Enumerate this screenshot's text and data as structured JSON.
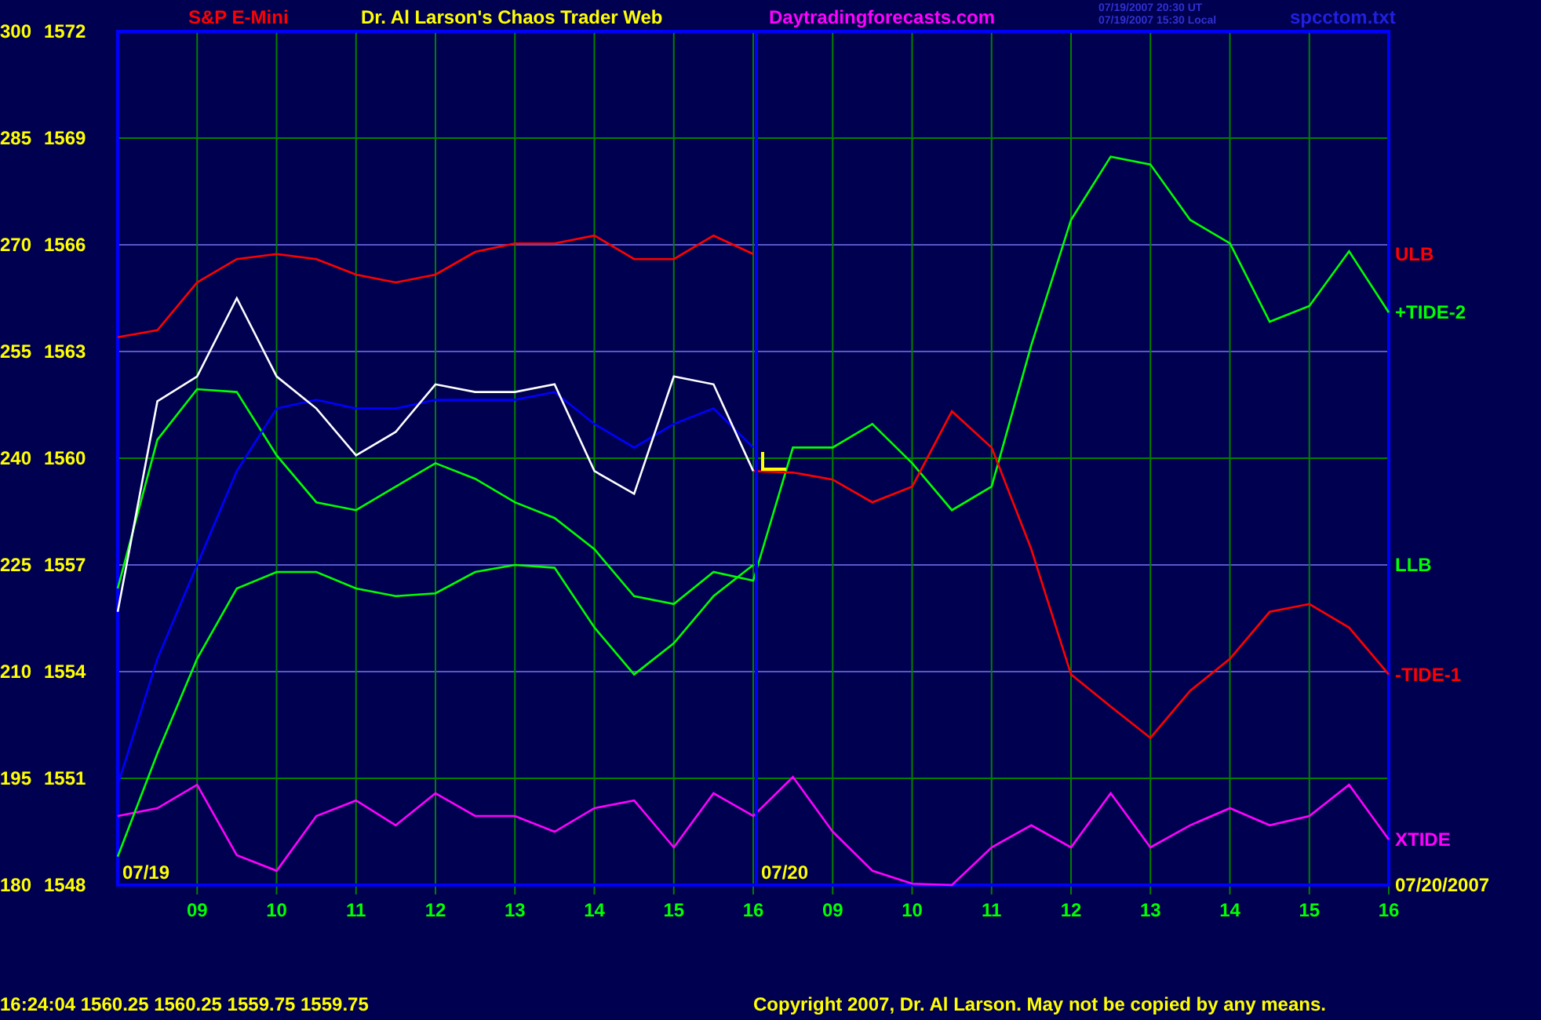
{
  "header": {
    "symbol": "S&P E-Mini",
    "title": "Dr. Al Larson's Chaos Trader Web",
    "website": "Daytradingforecasts.com",
    "timestamps": [
      "07/19/2007 20:30 UT",
      "07/19/2007 15:30 Local"
    ],
    "file": "spcctom.txt"
  },
  "chart": {
    "price_labels": [
      "1572",
      "1569",
      "1566",
      "1563",
      "1560",
      "1557",
      "1554",
      "1551",
      "1548"
    ],
    "chart_data": {
      "type": "line",
      "grid": true,
      "ylim": [
        180,
        300
      ],
      "categories": [
        null,
        null,
        "09",
        null,
        "10",
        null,
        "11",
        null,
        "12",
        null,
        "13",
        null,
        "14",
        null,
        "15",
        null,
        "16",
        null,
        "09",
        null,
        "10",
        null,
        "11",
        null,
        "12",
        null,
        "13",
        null,
        "14",
        null,
        "15",
        null,
        "16"
      ],
      "yticks": [
        300,
        285,
        270,
        255,
        240,
        225,
        210,
        195,
        180
      ],
      "series": [
        {
          "name": "XTIDE",
          "color": "#ff00ff",
          "values": [
            189.7,
            190.8,
            194.1,
            184.2,
            182,
            189.7,
            191.9,
            188.4,
            192.9,
            189.7,
            189.7,
            187.5,
            190.8,
            191.9,
            185.3,
            192.9,
            189.7,
            195.2,
            187.5,
            182,
            180.2,
            180,
            185.3,
            188.4,
            185.3,
            192.9,
            185.3,
            188.4,
            190.8,
            188.4,
            189.7,
            194.1,
            186.4
          ]
        },
        {
          "name": "LLB",
          "color": "#00ff00",
          "values": [
            184,
            198.5,
            211.8,
            221.7,
            224,
            224,
            221.7,
            220.6,
            221,
            224,
            225,
            224.6,
            216.2,
            209.6,
            214,
            220.6,
            225,
            null,
            null,
            null,
            null,
            null,
            null,
            null,
            null,
            null,
            null,
            null,
            null,
            null,
            null,
            null,
            null
          ]
        },
        {
          "name": "+TIDE-2",
          "color": "#00ff00",
          "values": [
            221.7,
            242.6,
            249.7,
            249.3,
            240.4,
            233.8,
            232.7,
            236,
            239.3,
            237.1,
            233.8,
            231.6,
            227.2,
            220.6,
            219.5,
            224,
            222.8,
            241.5,
            241.5,
            244.8,
            239.3,
            232.7,
            236,
            255.9,
            273.5,
            282.4,
            281.3,
            273.5,
            270.2,
            259.2,
            261.4,
            269.1,
            260.5
          ]
        },
        {
          "color": "#0000ff",
          "values": [
            194,
            211.8,
            225,
            238.2,
            247,
            248.2,
            247,
            247,
            248.2,
            248.2,
            248.2,
            249.3,
            244.8,
            241.5,
            244.8,
            247,
            241.5,
            null,
            null,
            null,
            null,
            null,
            null,
            null,
            null,
            null,
            null,
            null,
            null,
            null,
            null,
            null,
            null
          ]
        },
        {
          "name": "ULB",
          "color": "#ff0000",
          "values": [
            257,
            258,
            264.7,
            268,
            268.7,
            268,
            265.8,
            264.7,
            265.8,
            269,
            270.2,
            270.2,
            271.3,
            268,
            268,
            271.3,
            268.7,
            null,
            null,
            null,
            null,
            null,
            null,
            null,
            null,
            null,
            null,
            null,
            null,
            null,
            null,
            null,
            null
          ]
        },
        {
          "name": "-TIDE-1",
          "color": "#ff0000",
          "values": [
            null,
            null,
            null,
            null,
            null,
            null,
            null,
            null,
            null,
            null,
            null,
            null,
            null,
            null,
            null,
            null,
            238.2,
            238,
            237,
            233.8,
            236,
            246.6,
            241.5,
            227.2,
            209.6,
            205.1,
            200.7,
            207.3,
            211.8,
            218.4,
            219.5,
            216.2,
            209.6
          ]
        },
        {
          "color": "#ffffff",
          "values": [
            218.4,
            248,
            251.5,
            262.5,
            251.5,
            247,
            240.4,
            243.7,
            250.4,
            249.3,
            249.3,
            250.4,
            238.2,
            235,
            251.5,
            250.4,
            238.2,
            null,
            null,
            null,
            null,
            null,
            null,
            null,
            null,
            null,
            null,
            null,
            null,
            null,
            null,
            null,
            null
          ]
        }
      ],
      "annotations": [
        "07/19",
        "07/20",
        "07/20/2007"
      ]
    }
  },
  "status_bar": {
    "quote": "16:24:04  1560.25 1560.25 1559.75 1559.75",
    "copyright": "Copyright 2007, Dr. Al Larson. May not be copied by any means."
  }
}
